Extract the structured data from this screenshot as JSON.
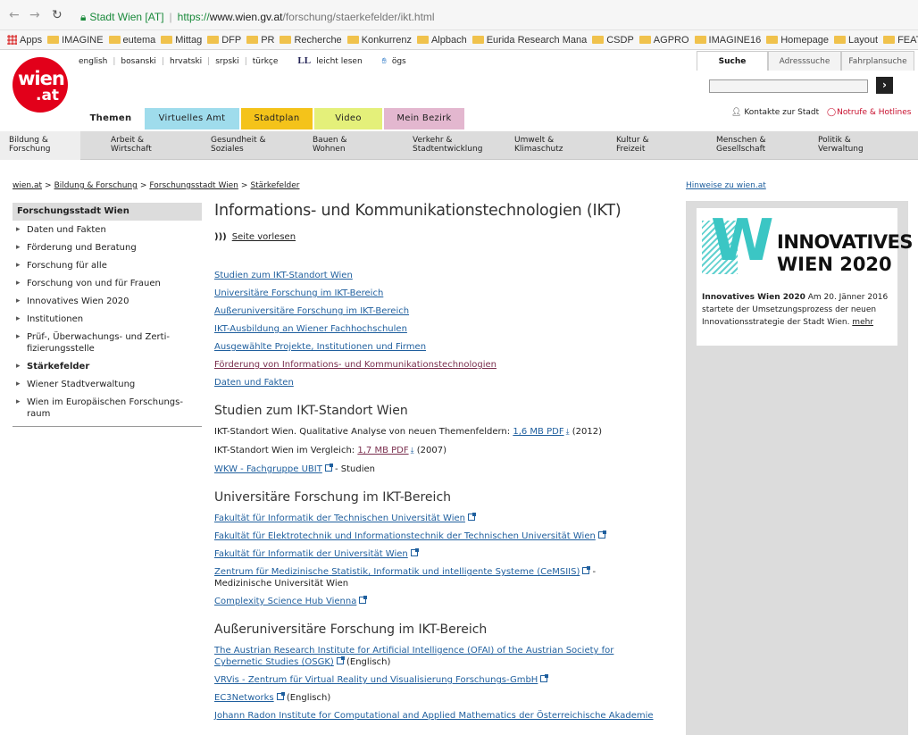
{
  "browser": {
    "site_name": "Stadt Wien [AT]",
    "url_proto": "https://",
    "url_domain": "www.wien.gv.at",
    "url_path": "/forschung/staerkefelder/ikt.html",
    "bookmarks": [
      "Apps",
      "IMAGINE",
      "eutema",
      "Mittag",
      "DFP",
      "PR",
      "Recherche",
      "Konkurrenz",
      "Alpbach",
      "Eurida Research Mana",
      "CSDP",
      "AGPRO",
      "IMAGINE16",
      "Homepage",
      "Layout",
      "FEAT"
    ]
  },
  "header": {
    "logo_line1": "wien",
    "logo_line2": ".at",
    "languages": [
      "english",
      "bosanski",
      "hrvatski",
      "srpski",
      "türkçe"
    ],
    "leicht_lesen": "leicht lesen",
    "ll_symbol": "LL",
    "oegs": "ögs",
    "main_tabs": [
      {
        "label": "Themen",
        "color": "#ffffff"
      },
      {
        "label": "Virtuelles Amt",
        "color": "#9fdcec"
      },
      {
        "label": "Stadtplan",
        "color": "#f4c31a"
      },
      {
        "label": "Video",
        "color": "#e4f07a"
      },
      {
        "label": "Mein Bezirk",
        "color": "#e3b7cf"
      }
    ],
    "search_tabs": [
      "Suche",
      "Adresssuche",
      "Fahrplansuche"
    ],
    "search_button": "›",
    "contact": "Kontakte zur Stadt",
    "emergency": "Notrufe & Hotlines"
  },
  "categories": [
    [
      "Bildung &",
      "Forschung"
    ],
    [
      "Arbeit &",
      "Wirtschaft"
    ],
    [
      "Gesundheit &",
      "Soziales"
    ],
    [
      "Bauen &",
      "Wohnen"
    ],
    [
      "Verkehr &",
      "Stadtentwicklung"
    ],
    [
      "Umwelt &",
      "Klimaschutz"
    ],
    [
      "Kultur &",
      "Freizeit"
    ],
    [
      "Menschen &",
      "Gesellschaft"
    ],
    [
      "Politik &",
      "Verwaltung"
    ]
  ],
  "breadcrumb": [
    "wien.at",
    "Bildung & Forschung",
    "Forschungsstadt Wien",
    "Stärkefelder"
  ],
  "hinweise": "Hinweise zu wien.at",
  "leftnav": {
    "heading": "Forschungsstadt Wien",
    "items": [
      "Daten und Fakten",
      "Förderung und Beratung",
      "Forschung für alle",
      "Forschung von und für Frauen",
      "Innovatives Wien 2020",
      "Institutionen",
      "Prüf-, Überwachungs- und Zerti-\nfizierungsstelle",
      "Stärkefelder",
      "Wiener Stadtverwaltung",
      "Wien im Europäischen Forschungs-\nraum"
    ]
  },
  "main": {
    "title": "Informations- und Kommunikationstechnologien (IKT)",
    "read_aloud": "Seite vorlesen",
    "toc": [
      "Studien zum IKT-Standort Wien",
      "Universitäre Forschung im IKT-Bereich",
      "Außeruniversitäre Forschung im IKT-Bereich",
      "IKT-Ausbildung an Wiener Fachhochschulen",
      "Ausgewählte Projekte, Institutionen und Firmen",
      "Förderung von Informations- und Kommunikationstechnologien",
      "Daten und Fakten"
    ],
    "sec1": {
      "heading": "Studien zum IKT-Standort Wien",
      "row1_text": "IKT-Standort Wien. Qualitative Analyse von neuen Themenfeldern:",
      "row1_link": "1,6 MB PDF",
      "row1_year": "(2012)",
      "row2_text": "IKT-Standort Wien im Vergleich:",
      "row2_link": "1,7 MB PDF",
      "row2_year": "(2007)",
      "row3_link": "WKW - Fachgruppe UBIT",
      "row3_suffix": "- Studien"
    },
    "sec2": {
      "heading": "Universitäre Forschung im IKT-Bereich",
      "links": [
        "Fakultät für Informatik der Technischen Universität Wien",
        "Fakultät für Elektrotechnik und Informationstechnik der Technischen Universität Wien",
        "Fakultät für Informatik der Universität Wien",
        "Zentrum für Medizinische Statistik, Informatik und intelligente Systeme (CeMSIIS)",
        "Complexity Science Hub Vienna"
      ],
      "cemsiis_suffix": "-",
      "cemsiis_line2": "Medizinische Universität Wien"
    },
    "sec3": {
      "heading": "Außeruniversitäre Forschung im IKT-Bereich",
      "ofai_line1": "The Austrian Research Institute for Artificial Intelligence (OFAI) of the Austrian Society for",
      "ofai_line2": "Cybernetic Studies (OSGK)",
      "english": "(Englisch)",
      "vrvis": "VRVis - Zentrum für Virtual Reality und Visualisierung Forschungs-GmbH",
      "ec3": "EC3Networks",
      "radon": "Johann Radon Institute for Computational and Applied Mathematics der Österreichische Akademie"
    }
  },
  "promo": {
    "img_letter": "W",
    "img_line1": "INNOVATIVES",
    "img_line2": "WIEN 2020",
    "bold": "Innovatives Wien 2020",
    "text": " Am 20. Jänner 2016 startete der Umsetzungsprozess der neuen Innovationsstrategie der Stadt Wien. ",
    "more": "mehr"
  }
}
